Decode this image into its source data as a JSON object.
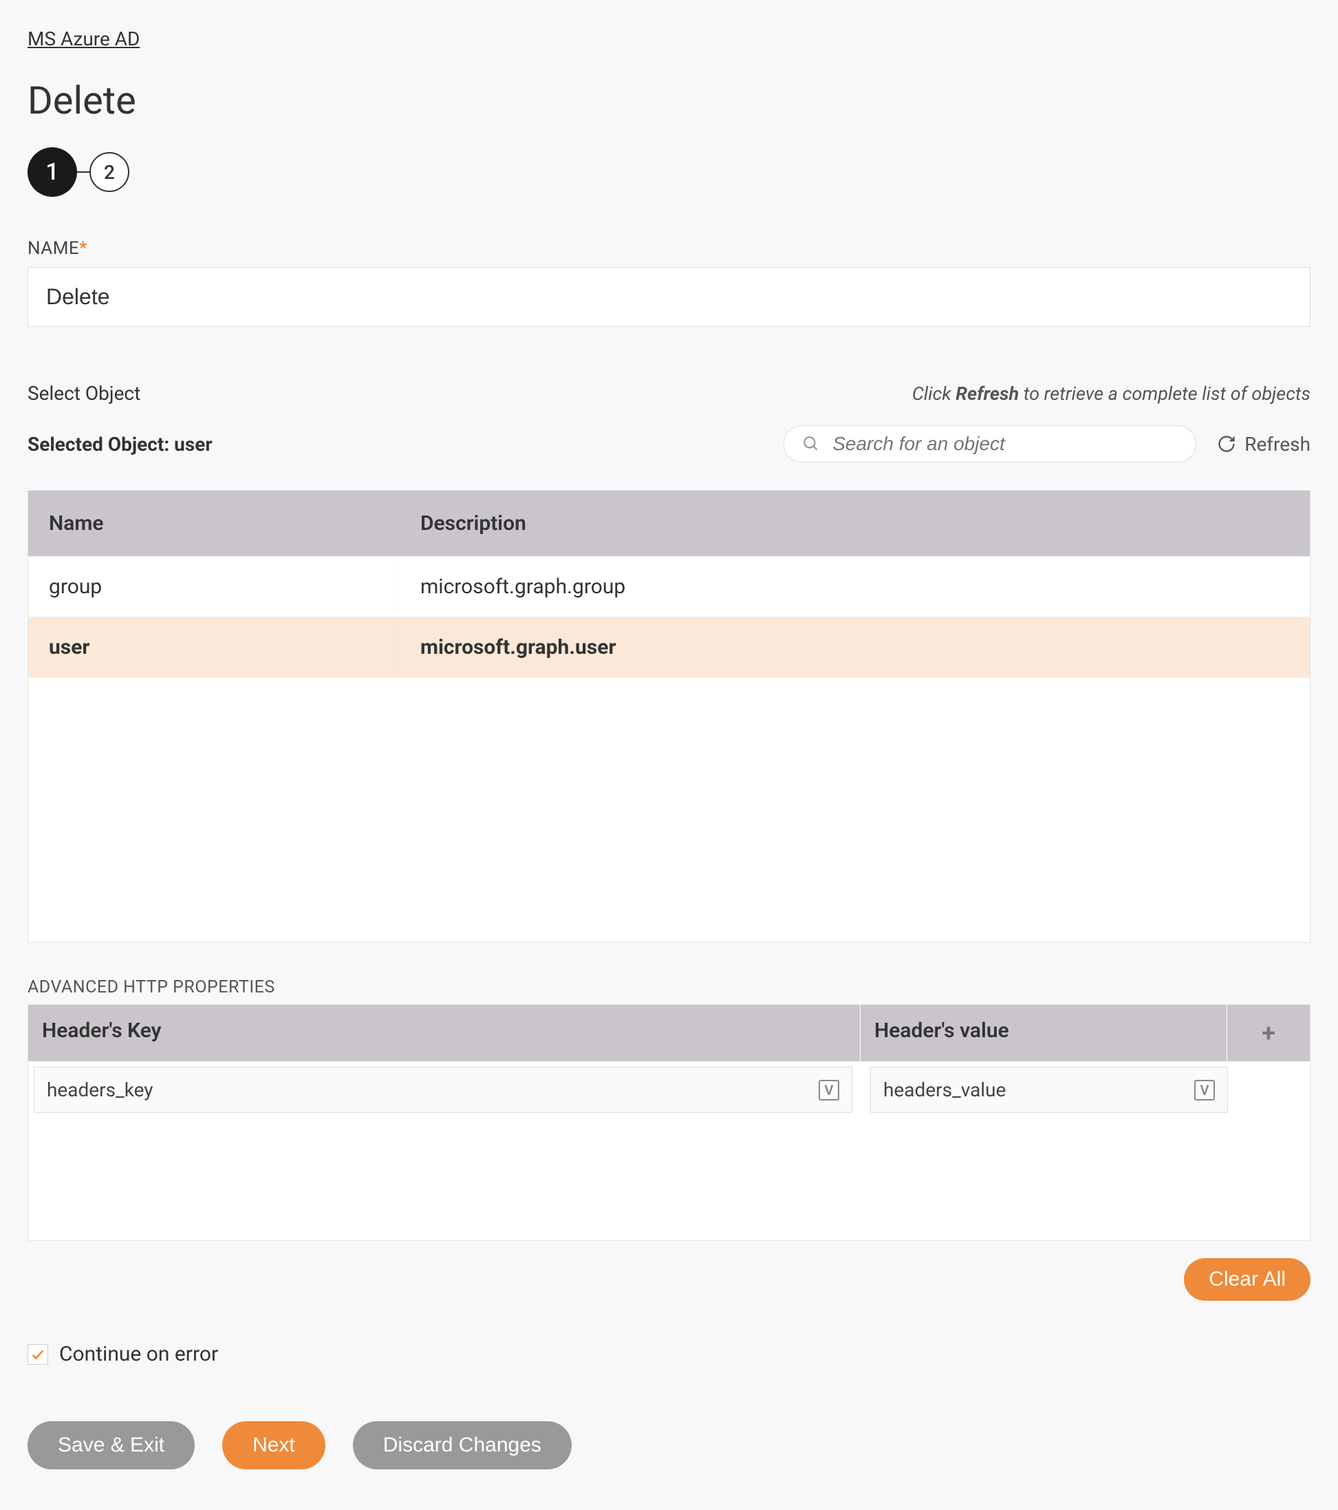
{
  "breadcrumb": "MS Azure AD",
  "page_title": "Delete",
  "stepper": {
    "step1": "1",
    "step2": "2"
  },
  "name_field": {
    "label": "NAME",
    "value": "Delete"
  },
  "select_object": {
    "label": "Select Object",
    "hint_prefix": "Click ",
    "hint_bold": "Refresh",
    "hint_suffix": " to retrieve a complete list of objects",
    "selected_prefix": "Selected Object: ",
    "selected_value": "user",
    "search_placeholder": "Search for an object",
    "refresh_label": "Refresh"
  },
  "object_table": {
    "col_name": "Name",
    "col_desc": "Description",
    "rows": [
      {
        "name": "group",
        "desc": "microsoft.graph.group",
        "selected": false
      },
      {
        "name": "user",
        "desc": "microsoft.graph.user",
        "selected": true
      }
    ]
  },
  "advanced_http": {
    "section_label": "ADVANCED HTTP PROPERTIES",
    "col_key": "Header's Key",
    "col_val": "Header's value",
    "row_key": "headers_key",
    "row_val": "headers_value"
  },
  "clear_all": "Clear All",
  "continue_on_error": {
    "label": "Continue on error",
    "checked": true
  },
  "footer": {
    "save_exit": "Save & Exit",
    "next": "Next",
    "discard": "Discard Changes"
  }
}
